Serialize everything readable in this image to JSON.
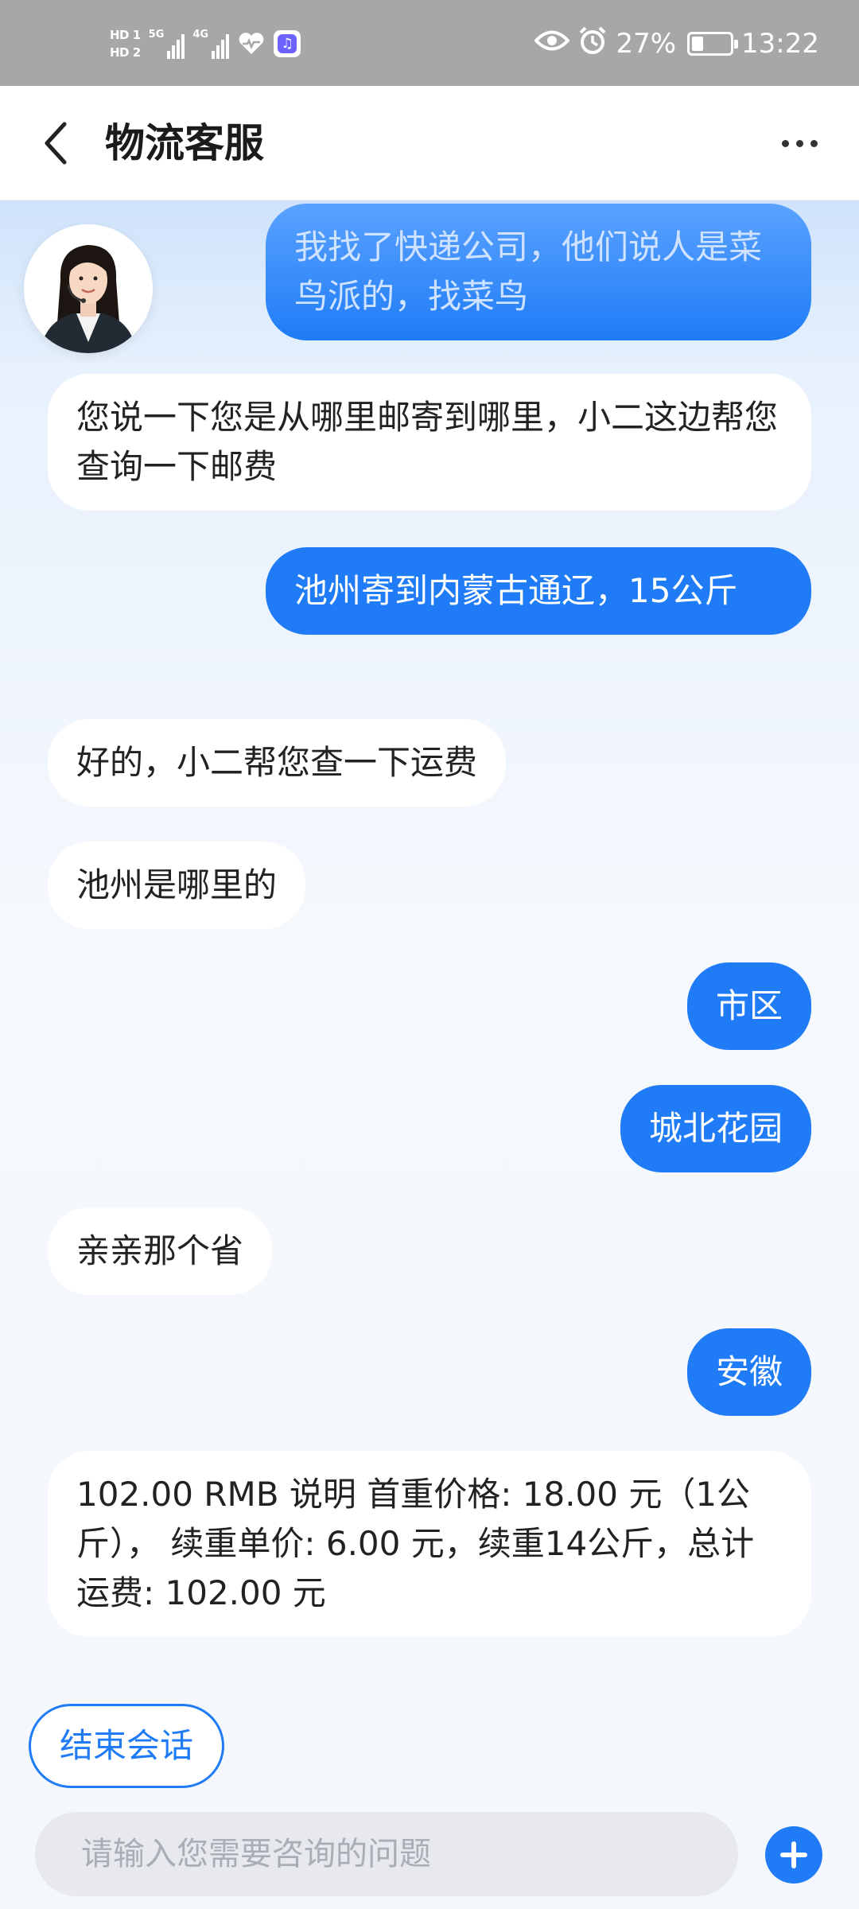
{
  "status_bar": {
    "sim1": "HD 1",
    "sim2": "HD 2",
    "net1": "5G",
    "net2": "4G",
    "battery": "27%",
    "battery_level": 0.27,
    "time": "13:22"
  },
  "header": {
    "title": "物流客服"
  },
  "messages": [
    {
      "from": "user",
      "text": "我找了快递公司，他们说人是菜鸟派的，找菜鸟"
    },
    {
      "from": "agent",
      "text": "您说一下您是从哪里邮寄到哪里，小二这边帮您查询一下邮费"
    },
    {
      "from": "user",
      "text": "池州寄到内蒙古通辽，15公斤"
    },
    {
      "from": "agent",
      "text": "好的，小二帮您查一下运费"
    },
    {
      "from": "agent",
      "text": "池州是哪里的"
    },
    {
      "from": "user",
      "text": "市区"
    },
    {
      "from": "user",
      "text": "城北花园"
    },
    {
      "from": "agent",
      "text": "亲亲那个省"
    },
    {
      "from": "user",
      "text": "安徽"
    },
    {
      "from": "agent",
      "text": "102.00 RMB 说明 首重价格: 18.00 元（1公斤）， 续重单价: 6.00 元，续重14公斤，总计运费: 102.00 元"
    }
  ],
  "footer": {
    "end_session_label": "结束会话",
    "input_placeholder": "请输入您需要咨询的问题"
  },
  "colors": {
    "accent": "#1f7cf6",
    "status_bar": "#a7a7a7"
  },
  "icons": [
    "back-arrow-icon",
    "more-dots-icon",
    "plus-icon",
    "eye-icon",
    "alarm-icon",
    "battery-icon",
    "heart-icon",
    "music-icon"
  ]
}
